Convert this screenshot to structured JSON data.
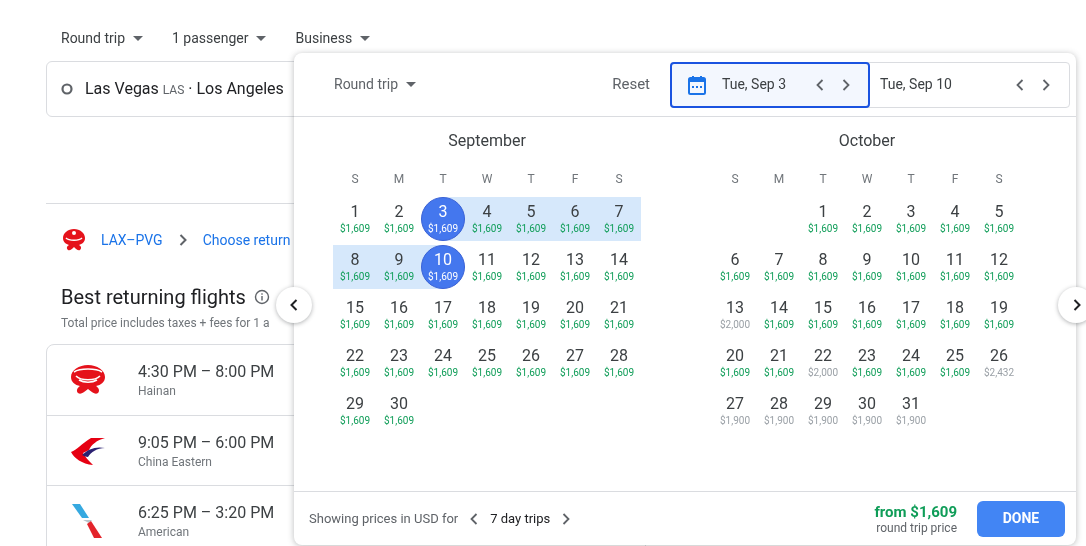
{
  "trip_options": [
    {
      "label": "Round trip"
    },
    {
      "label": "1 passenger"
    },
    {
      "label": "Business"
    }
  ],
  "search": {
    "origin": "Las Vegas",
    "origin_code": "LAS",
    "separator": "·",
    "destination": "Los Angeles"
  },
  "breadcrumb": {
    "route": "LAX–PVG",
    "next": "Choose return"
  },
  "results": {
    "title": "Best returning flights",
    "subtitle": "Total price includes taxes + fees for 1 a"
  },
  "flights": [
    {
      "times": "4:30 PM – 8:00 PM",
      "airline": "Hainan",
      "kind": "swirl"
    },
    {
      "times": "9:05 PM – 6:00 PM",
      "airline": "China Eastern",
      "kind": "swallow"
    },
    {
      "times": "6:25 PM – 3:20 PM",
      "airline": "American",
      "kind": "tail"
    }
  ],
  "date_picker": {
    "trip_type": "Round trip",
    "reset": "Reset",
    "dates": [
      {
        "label": "Tue, Sep 3",
        "selected": true
      },
      {
        "label": "Tue, Sep 10",
        "selected": false
      }
    ],
    "months": [
      {
        "name": "September",
        "weekdays": [
          "S",
          "M",
          "T",
          "W",
          "T",
          "F",
          "S"
        ],
        "weeks": [
          [
            {
              "kind": "day",
              "day": "1",
              "price": "$1,609",
              "low": true,
              "selected": false,
              "in_range": false
            },
            {
              "kind": "day",
              "day": "2",
              "price": "$1,609",
              "low": true,
              "selected": false,
              "in_range": false
            },
            {
              "kind": "day",
              "day": "3",
              "price": "$1,609",
              "low": true,
              "selected": true,
              "in_range": false
            },
            {
              "kind": "day",
              "day": "4",
              "price": "$1,609",
              "low": true,
              "selected": false,
              "in_range": true
            },
            {
              "kind": "day",
              "day": "5",
              "price": "$1,609",
              "low": true,
              "selected": false,
              "in_range": true
            },
            {
              "kind": "day",
              "day": "6",
              "price": "$1,609",
              "low": true,
              "selected": false,
              "in_range": true
            },
            {
              "kind": "day",
              "day": "7",
              "price": "$1,609",
              "low": true,
              "selected": false,
              "in_range": true
            }
          ],
          [
            {
              "kind": "day",
              "day": "8",
              "price": "$1,609",
              "low": true,
              "selected": false,
              "in_range": true
            },
            {
              "kind": "day",
              "day": "9",
              "price": "$1,609",
              "low": true,
              "selected": false,
              "in_range": true
            },
            {
              "kind": "day",
              "day": "10",
              "price": "$1,609",
              "low": true,
              "selected": true,
              "in_range": false
            },
            {
              "kind": "day",
              "day": "11",
              "price": "$1,609",
              "low": true,
              "selected": false,
              "in_range": false
            },
            {
              "kind": "day",
              "day": "12",
              "price": "$1,609",
              "low": true,
              "selected": false,
              "in_range": false
            },
            {
              "kind": "day",
              "day": "13",
              "price": "$1,609",
              "low": true,
              "selected": false,
              "in_range": false
            },
            {
              "kind": "day",
              "day": "14",
              "price": "$1,609",
              "low": true,
              "selected": false,
              "in_range": false
            }
          ],
          [
            {
              "kind": "day",
              "day": "15",
              "price": "$1,609",
              "low": true,
              "selected": false,
              "in_range": false
            },
            {
              "kind": "day",
              "day": "16",
              "price": "$1,609",
              "low": true,
              "selected": false,
              "in_range": false
            },
            {
              "kind": "day",
              "day": "17",
              "price": "$1,609",
              "low": true,
              "selected": false,
              "in_range": false
            },
            {
              "kind": "day",
              "day": "18",
              "price": "$1,609",
              "low": true,
              "selected": false,
              "in_range": false
            },
            {
              "kind": "day",
              "day": "19",
              "price": "$1,609",
              "low": true,
              "selected": false,
              "in_range": false
            },
            {
              "kind": "day",
              "day": "20",
              "price": "$1,609",
              "low": true,
              "selected": false,
              "in_range": false
            },
            {
              "kind": "day",
              "day": "21",
              "price": "$1,609",
              "low": true,
              "selected": false,
              "in_range": false
            }
          ],
          [
            {
              "kind": "day",
              "day": "22",
              "price": "$1,609",
              "low": true,
              "selected": false,
              "in_range": false
            },
            {
              "kind": "day",
              "day": "23",
              "price": "$1,609",
              "low": true,
              "selected": false,
              "in_range": false
            },
            {
              "kind": "day",
              "day": "24",
              "price": "$1,609",
              "low": true,
              "selected": false,
              "in_range": false
            },
            {
              "kind": "day",
              "day": "25",
              "price": "$1,609",
              "low": true,
              "selected": false,
              "in_range": false
            },
            {
              "kind": "day",
              "day": "26",
              "price": "$1,609",
              "low": true,
              "selected": false,
              "in_range": false
            },
            {
              "kind": "day",
              "day": "27",
              "price": "$1,609",
              "low": true,
              "selected": false,
              "in_range": false
            },
            {
              "kind": "day",
              "day": "28",
              "price": "$1,609",
              "low": true,
              "selected": false,
              "in_range": false
            }
          ],
          [
            {
              "kind": "day",
              "day": "29",
              "price": "$1,609",
              "low": true,
              "selected": false,
              "in_range": false
            },
            {
              "kind": "day",
              "day": "30",
              "price": "$1,609",
              "low": true,
              "selected": false,
              "in_range": false
            }
          ]
        ]
      },
      {
        "name": "October",
        "weekdays": [
          "S",
          "M",
          "T",
          "W",
          "T",
          "F",
          "S"
        ],
        "weeks": [
          [
            {
              "kind": "empty"
            },
            {
              "kind": "empty"
            },
            {
              "kind": "day",
              "day": "1",
              "price": "$1,609",
              "low": true,
              "selected": false,
              "in_range": false
            },
            {
              "kind": "day",
              "day": "2",
              "price": "$1,609",
              "low": true,
              "selected": false,
              "in_range": false
            },
            {
              "kind": "day",
              "day": "3",
              "price": "$1,609",
              "low": true,
              "selected": false,
              "in_range": false
            },
            {
              "kind": "day",
              "day": "4",
              "price": "$1,609",
              "low": true,
              "selected": false,
              "in_range": false
            },
            {
              "kind": "day",
              "day": "5",
              "price": "$1,609",
              "low": true,
              "selected": false,
              "in_range": false
            }
          ],
          [
            {
              "kind": "day",
              "day": "6",
              "price": "$1,609",
              "low": true,
              "selected": false,
              "in_range": false
            },
            {
              "kind": "day",
              "day": "7",
              "price": "$1,609",
              "low": true,
              "selected": false,
              "in_range": false
            },
            {
              "kind": "day",
              "day": "8",
              "price": "$1,609",
              "low": true,
              "selected": false,
              "in_range": false
            },
            {
              "kind": "day",
              "day": "9",
              "price": "$1,609",
              "low": true,
              "selected": false,
              "in_range": false
            },
            {
              "kind": "day",
              "day": "10",
              "price": "$1,609",
              "low": true,
              "selected": false,
              "in_range": false
            },
            {
              "kind": "day",
              "day": "11",
              "price": "$1,609",
              "low": true,
              "selected": false,
              "in_range": false
            },
            {
              "kind": "day",
              "day": "12",
              "price": "$1,609",
              "low": true,
              "selected": false,
              "in_range": false
            }
          ],
          [
            {
              "kind": "day",
              "day": "13",
              "price": "$2,000",
              "low": false,
              "selected": false,
              "in_range": false
            },
            {
              "kind": "day",
              "day": "14",
              "price": "$1,609",
              "low": true,
              "selected": false,
              "in_range": false
            },
            {
              "kind": "day",
              "day": "15",
              "price": "$1,609",
              "low": true,
              "selected": false,
              "in_range": false
            },
            {
              "kind": "day",
              "day": "16",
              "price": "$1,609",
              "low": true,
              "selected": false,
              "in_range": false
            },
            {
              "kind": "day",
              "day": "17",
              "price": "$1,609",
              "low": true,
              "selected": false,
              "in_range": false
            },
            {
              "kind": "day",
              "day": "18",
              "price": "$1,609",
              "low": true,
              "selected": false,
              "in_range": false
            },
            {
              "kind": "day",
              "day": "19",
              "price": "$1,609",
              "low": true,
              "selected": false,
              "in_range": false
            }
          ],
          [
            {
              "kind": "day",
              "day": "20",
              "price": "$1,609",
              "low": true,
              "selected": false,
              "in_range": false
            },
            {
              "kind": "day",
              "day": "21",
              "price": "$1,609",
              "low": true,
              "selected": false,
              "in_range": false
            },
            {
              "kind": "day",
              "day": "22",
              "price": "$2,000",
              "low": false,
              "selected": false,
              "in_range": false
            },
            {
              "kind": "day",
              "day": "23",
              "price": "$1,609",
              "low": true,
              "selected": false,
              "in_range": false
            },
            {
              "kind": "day",
              "day": "24",
              "price": "$1,609",
              "low": true,
              "selected": false,
              "in_range": false
            },
            {
              "kind": "day",
              "day": "25",
              "price": "$1,609",
              "low": true,
              "selected": false,
              "in_range": false
            },
            {
              "kind": "day",
              "day": "26",
              "price": "$2,432",
              "low": false,
              "selected": false,
              "in_range": false
            }
          ],
          [
            {
              "kind": "day",
              "day": "27",
              "price": "$1,900",
              "low": false,
              "selected": false,
              "in_range": false
            },
            {
              "kind": "day",
              "day": "28",
              "price": "$1,900",
              "low": false,
              "selected": false,
              "in_range": false
            },
            {
              "kind": "day",
              "day": "29",
              "price": "$1,900",
              "low": false,
              "selected": false,
              "in_range": false
            },
            {
              "kind": "day",
              "day": "30",
              "price": "$1,900",
              "low": false,
              "selected": false,
              "in_range": false
            },
            {
              "kind": "day",
              "day": "31",
              "price": "$1,900",
              "low": false,
              "selected": false,
              "in_range": false
            }
          ]
        ]
      }
    ],
    "footer": {
      "note": "Showing prices in USD for",
      "duration": "7 day trips",
      "price": "from $1,609",
      "price_note": "round trip price",
      "done": "DONE"
    }
  }
}
